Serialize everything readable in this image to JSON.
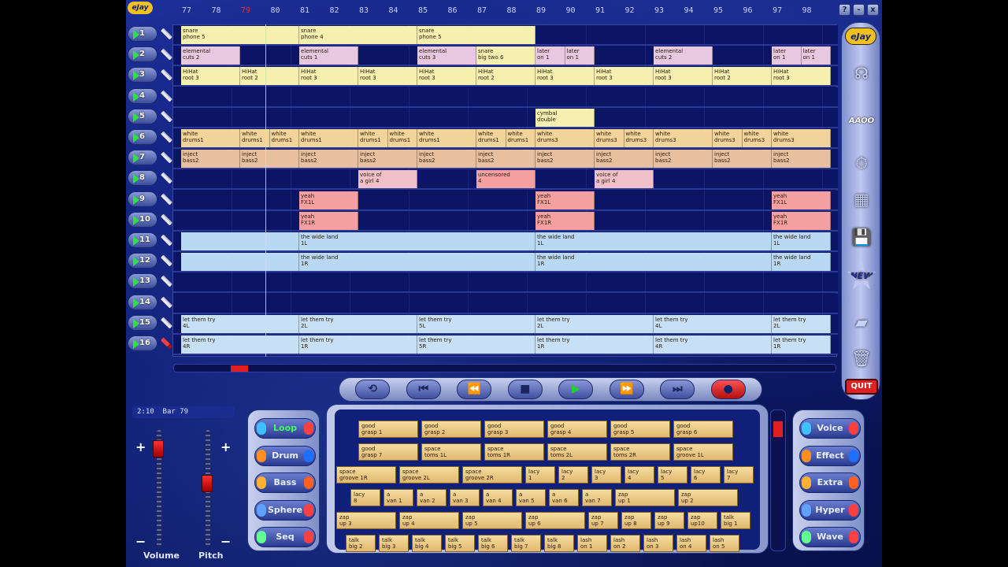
{
  "app": {
    "logo_text": "eJay"
  },
  "ruler": {
    "bars": [
      "77",
      "78",
      "79",
      "80",
      "81",
      "82",
      "83",
      "84",
      "85",
      "86",
      "87",
      "88",
      "89",
      "90",
      "91",
      "92",
      "93",
      "94",
      "95",
      "96",
      "97",
      "98"
    ],
    "current": "79"
  },
  "window_buttons": [
    "?",
    "-",
    "x"
  ],
  "tracks": [
    {
      "num": "1",
      "clips": [
        {
          "x": 77,
          "len": 2,
          "text": "snare\nphone 5",
          "color": "#f5f0b0"
        },
        {
          "x": 81,
          "len": 2,
          "text": "snare\nphone 4",
          "color": "#f5f0b0"
        },
        {
          "x": 85,
          "len": 2,
          "text": "snare\nphone 5",
          "color": "#f5f0b0"
        }
      ]
    },
    {
      "num": "2",
      "clips": [
        {
          "x": 77,
          "len": 1,
          "text": "elemental\ncuts 2",
          "color": "#e8c8e0"
        },
        {
          "x": 81,
          "len": 1,
          "text": "elemental\ncuts 1",
          "color": "#e8c8e0"
        },
        {
          "x": 85,
          "len": 1,
          "text": "elemental\ncuts 3",
          "color": "#e8c8e0"
        },
        {
          "x": 87,
          "len": 1,
          "text": "snare\nbig two 6",
          "color": "#f5f0b0"
        },
        {
          "x": 89,
          "len": 0.5,
          "text": "later\non 1",
          "color": "#e8c8e0"
        },
        {
          "x": 90,
          "len": 0.5,
          "text": "later\non 1",
          "color": "#e8c8e0"
        },
        {
          "x": 93,
          "len": 1,
          "text": "elemental\ncuts 2",
          "color": "#e8c8e0"
        },
        {
          "x": 97,
          "len": 0.5,
          "text": "later\non 1",
          "color": "#e8c8e0"
        },
        {
          "x": 98,
          "len": 0.5,
          "text": "later\non 1",
          "color": "#e8c8e0"
        }
      ]
    },
    {
      "num": "3",
      "clips": [
        {
          "x": 77,
          "len": 1,
          "text": "HiHat\nroot 3",
          "color": "#f5f0b0"
        },
        {
          "x": 79,
          "len": 1,
          "text": "HiHat\nroot 2",
          "color": "#f5f0b0"
        },
        {
          "x": 81,
          "len": 1,
          "text": "HiHat\nroot 3",
          "color": "#f5f0b0"
        },
        {
          "x": 83,
          "len": 1,
          "text": "HiHat\nroot 3",
          "color": "#f5f0b0"
        },
        {
          "x": 85,
          "len": 1,
          "text": "HiHat\nroot 3",
          "color": "#f5f0b0"
        },
        {
          "x": 87,
          "len": 1,
          "text": "HiHat\nroot 2",
          "color": "#f5f0b0"
        },
        {
          "x": 89,
          "len": 1,
          "text": "HiHat\nroot 3",
          "color": "#f5f0b0"
        },
        {
          "x": 91,
          "len": 1,
          "text": "HiHat\nroot 3",
          "color": "#f5f0b0"
        },
        {
          "x": 93,
          "len": 1,
          "text": "HiHat\nroot 3",
          "color": "#f5f0b0"
        },
        {
          "x": 95,
          "len": 1,
          "text": "HiHat\nroot 2",
          "color": "#f5f0b0"
        },
        {
          "x": 97,
          "len": 1,
          "text": "HiHat\nroot 3",
          "color": "#f5f0b0"
        }
      ]
    },
    {
      "num": "4",
      "clips": []
    },
    {
      "num": "5",
      "clips": [
        {
          "x": 89,
          "len": 1,
          "text": "cymbal\ndouble",
          "color": "#f5f0b0"
        }
      ]
    },
    {
      "num": "6",
      "clips": [
        {
          "x": 77,
          "len": 1,
          "text": "white\ndrums1",
          "color": "#f2d49a"
        },
        {
          "x": 79,
          "len": 0.5,
          "text": "white\ndrums1",
          "color": "#f2d49a"
        },
        {
          "x": 80,
          "len": 0.5,
          "text": "white\ndrums1",
          "color": "#f2d49a"
        },
        {
          "x": 81,
          "len": 1,
          "text": "white\ndrums1",
          "color": "#f2d49a"
        },
        {
          "x": 83,
          "len": 0.5,
          "text": "white\ndrums1",
          "color": "#f2d49a"
        },
        {
          "x": 84,
          "len": 0.5,
          "text": "white\ndrums1",
          "color": "#f2d49a"
        },
        {
          "x": 85,
          "len": 1,
          "text": "white\ndrums1",
          "color": "#f2d49a"
        },
        {
          "x": 87,
          "len": 0.5,
          "text": "white\ndrums1",
          "color": "#f2d49a"
        },
        {
          "x": 88,
          "len": 0.5,
          "text": "white\ndrums1",
          "color": "#f2d49a"
        },
        {
          "x": 89,
          "len": 1,
          "text": "white\ndrums3",
          "color": "#f2d49a"
        },
        {
          "x": 91,
          "len": 0.5,
          "text": "white\ndrums3",
          "color": "#f2d49a"
        },
        {
          "x": 92,
          "len": 0.5,
          "text": "white\ndrums3",
          "color": "#f2d49a"
        },
        {
          "x": 93,
          "len": 1,
          "text": "white\ndrums3",
          "color": "#f2d49a"
        },
        {
          "x": 95,
          "len": 0.5,
          "text": "white\ndrums3",
          "color": "#f2d49a"
        },
        {
          "x": 96,
          "len": 0.5,
          "text": "white\ndrums3",
          "color": "#f2d49a"
        },
        {
          "x": 97,
          "len": 1,
          "text": "white\ndrums3",
          "color": "#f2d49a"
        }
      ]
    },
    {
      "num": "7",
      "clips": [
        {
          "x": 77,
          "len": 1,
          "text": "inject\nbass2",
          "color": "#e8c0a0"
        },
        {
          "x": 79,
          "len": 1,
          "text": "inject\nbass2",
          "color": "#e8c0a0"
        },
        {
          "x": 81,
          "len": 1,
          "text": "inject\nbass2",
          "color": "#e8c0a0"
        },
        {
          "x": 83,
          "len": 1,
          "text": "inject\nbass2",
          "color": "#e8c0a0"
        },
        {
          "x": 85,
          "len": 1,
          "text": "inject\nbass2",
          "color": "#e8c0a0"
        },
        {
          "x": 87,
          "len": 1,
          "text": "inject\nbass2",
          "color": "#e8c0a0"
        },
        {
          "x": 89,
          "len": 1,
          "text": "inject\nbass2",
          "color": "#e8c0a0"
        },
        {
          "x": 91,
          "len": 1,
          "text": "inject\nbass2",
          "color": "#e8c0a0"
        },
        {
          "x": 93,
          "len": 1,
          "text": "inject\nbass2",
          "color": "#e8c0a0"
        },
        {
          "x": 95,
          "len": 1,
          "text": "inject\nbass2",
          "color": "#e8c0a0"
        },
        {
          "x": 97,
          "len": 1,
          "text": "inject\nbass2",
          "color": "#e8c0a0"
        }
      ]
    },
    {
      "num": "8",
      "clips": [
        {
          "x": 83,
          "len": 1,
          "text": "voice of\na girl 4",
          "color": "#f0c0c8"
        },
        {
          "x": 87,
          "len": 1,
          "text": "uncensored\n4",
          "color": "#f4a0a0"
        },
        {
          "x": 91,
          "len": 1,
          "text": "voice of\na girl 4",
          "color": "#f0c0c8"
        }
      ]
    },
    {
      "num": "9",
      "clips": [
        {
          "x": 81,
          "len": 1,
          "text": "yeah\nFX1L",
          "color": "#f4a0a0"
        },
        {
          "x": 89,
          "len": 1,
          "text": "yeah\nFX1L",
          "color": "#f4a0a0"
        },
        {
          "x": 97,
          "len": 1,
          "text": "yeah\nFX1L",
          "color": "#f4a0a0"
        }
      ]
    },
    {
      "num": "10",
      "clips": [
        {
          "x": 81,
          "len": 1,
          "text": "yeah\nFX1R",
          "color": "#f4a0a0"
        },
        {
          "x": 89,
          "len": 1,
          "text": "yeah\nFX1R",
          "color": "#f4a0a0"
        },
        {
          "x": 97,
          "len": 1,
          "text": "yeah\nFX1R",
          "color": "#f4a0a0"
        }
      ]
    },
    {
      "num": "11",
      "clips": [
        {
          "x": 77,
          "len": 2,
          "text": "",
          "color": "#b8d8f4"
        },
        {
          "x": 81,
          "len": 4,
          "text": "the wide land\n1L",
          "color": "#b8d8f4"
        },
        {
          "x": 89,
          "len": 4,
          "text": "the wide land\n1L",
          "color": "#b8d8f4"
        },
        {
          "x": 97,
          "len": 1,
          "text": "the wide land\n1L",
          "color": "#b8d8f4"
        }
      ]
    },
    {
      "num": "12",
      "clips": [
        {
          "x": 77,
          "len": 2,
          "text": "",
          "color": "#b8d8f4"
        },
        {
          "x": 81,
          "len": 4,
          "text": "the wide land\n1R",
          "color": "#b8d8f4"
        },
        {
          "x": 89,
          "len": 4,
          "text": "the wide land\n1R",
          "color": "#b8d8f4"
        },
        {
          "x": 97,
          "len": 1,
          "text": "the wide land\n1R",
          "color": "#b8d8f4"
        }
      ]
    },
    {
      "num": "13",
      "clips": []
    },
    {
      "num": "14",
      "clips": []
    },
    {
      "num": "15",
      "clips": [
        {
          "x": 77,
          "len": 2,
          "text": "let them try\n4L",
          "color": "#c8e0f6"
        },
        {
          "x": 81,
          "len": 2,
          "text": "let them try\n2L",
          "color": "#c8e0f6"
        },
        {
          "x": 85,
          "len": 2,
          "text": "let them try\n5L",
          "color": "#c8e0f6"
        },
        {
          "x": 89,
          "len": 2,
          "text": "let them try\n2L",
          "color": "#c8e0f6"
        },
        {
          "x": 93,
          "len": 2,
          "text": "let them try\n4L",
          "color": "#c8e0f6"
        },
        {
          "x": 97,
          "len": 1,
          "text": "let them try\n2L",
          "color": "#c8e0f6"
        }
      ]
    },
    {
      "num": "16",
      "clips": [
        {
          "x": 77,
          "len": 2,
          "text": "let them try\n4R",
          "color": "#c8e0f6"
        },
        {
          "x": 81,
          "len": 2,
          "text": "let them try\n1R",
          "color": "#c8e0f6"
        },
        {
          "x": 85,
          "len": 2,
          "text": "let them try\n5R",
          "color": "#c8e0f6"
        },
        {
          "x": 89,
          "len": 2,
          "text": "let them try\n1R",
          "color": "#c8e0f6"
        },
        {
          "x": 93,
          "len": 2,
          "text": "let them try\n4R",
          "color": "#c8e0f6"
        },
        {
          "x": 97,
          "len": 1,
          "text": "let them try\n1R",
          "color": "#c8e0f6"
        }
      ]
    }
  ],
  "transport": {
    "buttons": [
      "⟲",
      "⏮",
      "⏪",
      "■",
      "▶",
      "⏩",
      "⏭",
      "●"
    ]
  },
  "status": {
    "time": "2:10",
    "bar_label": "Bar 79"
  },
  "sliders": {
    "volume_label": "Volume",
    "pitch_label": "Pitch",
    "volume_level": 0.9,
    "pitch_level": 0.55
  },
  "left_categories": [
    "Loop",
    "Drum",
    "Bass",
    "Sphere",
    "Seq"
  ],
  "left_active": "Loop",
  "right_categories": [
    "Voice",
    "Effect",
    "Extra",
    "Hyper",
    "Wave"
  ],
  "samples": [
    [
      "good\ngrasp 1",
      "good\ngrasp 2",
      "good\ngrasp 3",
      "good\ngrasp 4",
      "good\ngrasp 5",
      "good\ngrasp 6"
    ],
    [
      "good\ngrasp 7",
      "space\ntoms 1L",
      "space\ntoms 1R",
      "space\ntoms 2L",
      "space\ntoms 2R",
      "space\ngroove 1L"
    ],
    [
      "space\ngroove 1R",
      "space\ngroove 2L",
      "space\ngroove 2R",
      "lacy\n1",
      "lacy\n2",
      "lacy\n3",
      "lacy\n4",
      "lacy\n5",
      "lacy\n6",
      "lacy\n7"
    ],
    [
      "lacy\n8",
      "a\nvan 1",
      "a\nvan 2",
      "a\nvan 3",
      "a\nvan 4",
      "a\nvan 5",
      "a\nvan 6",
      "a\nvan 7",
      "zap\nup 1",
      "zap\nup 2"
    ],
    [
      "zap\nup 3",
      "zap\nup 4",
      "zap\nup 5",
      "zap\nup 6",
      "zap\nup 7",
      "zap\nup 8",
      "zap\nup 9",
      "zap\nup10",
      "talk\nbig 1"
    ],
    [
      "talk\nbig 2",
      "talk\nbig 3",
      "talk\nbig 4",
      "talk\nbig 5",
      "talk\nbig 6",
      "talk\nbig 7",
      "talk\nbig 8",
      "lash\non 1",
      "lash\non 2",
      "lash\non 3",
      "lash\non 4",
      "lash\non 5"
    ]
  ],
  "right_bar": {
    "logo": "eJay",
    "new_label": "NEW",
    "aaoo_label": "AAOO",
    "quit_label": "QUIT"
  }
}
